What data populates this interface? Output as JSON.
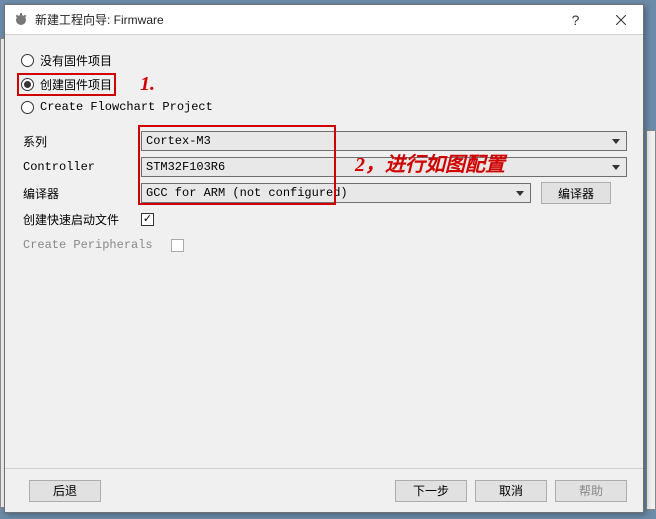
{
  "window": {
    "title": "新建工程向导: Firmware"
  },
  "radios": {
    "none": "没有固件项目",
    "create": "创建固件项目",
    "flowchart": "Create Flowchart Project"
  },
  "annotations": {
    "one": "1.",
    "two": "2，进行如图配置"
  },
  "form": {
    "series_label": "系列",
    "series_value": "Cortex-M3",
    "controller_label": "Controller",
    "controller_value": "STM32F103R6",
    "compiler_label": "编译器",
    "compiler_value": "GCC for ARM (not configured)",
    "compiler_btn": "编译器",
    "quickstart_label": "创建快速启动文件",
    "peripherals_label": "Create Peripherals"
  },
  "buttons": {
    "back": "后退",
    "next": "下一步",
    "cancel": "取消",
    "help": "帮助"
  }
}
